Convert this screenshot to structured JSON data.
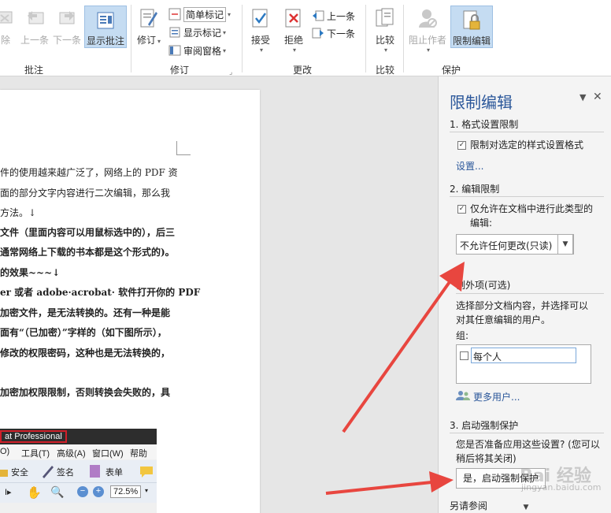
{
  "ribbon": {
    "buttons": {
      "delete": "除",
      "prev": "上一条",
      "next": "下一条",
      "show_comments": "显示批注",
      "track": "修订",
      "markup_select": "简单标记",
      "show_markup": "显示标记",
      "review_pane": "审阅窗格",
      "accept": "接受",
      "reject": "拒绝",
      "prev_change": "上一条",
      "next_change": "下一条",
      "compare": "比较",
      "block_authors": "阻止作者",
      "restrict_editing": "限制编辑"
    },
    "groups": {
      "comments": "批注",
      "tracking": "修订",
      "changes": "更改",
      "compare": "比较",
      "protect": "保护"
    }
  },
  "document": {
    "lines": [
      "件的使用越来越广泛了，网络上的 PDF 资",
      "面的部分文字内容进行二次编辑，那么我",
      "方法。↓",
      "文件（里面内容可以用鼠标选中的），后三",
      "通常网络上下载的书本都是这个形式的)。",
      "的效果~~~↓",
      "er 或者 adobe·acrobat· 软件打开你的 PDF",
      "加密文件，是无法转换的。还有一种是能",
      "面有“（已加密）”字样的（如下图所示），",
      "修改的权限密码，这种也是无法转换的，",
      "加密加权限限制，否则转换会失败的，具"
    ],
    "embedded": {
      "title": "at Professional",
      "menu": [
        "O)",
        "工具(T)",
        "高级(A)",
        "窗口(W)",
        "帮助(H)"
      ],
      "tools": [
        "安全",
        "签名",
        "表单"
      ],
      "zoom": "72.5%"
    }
  },
  "pane": {
    "title": "限制编辑",
    "section1": "1. 格式设置限制",
    "format_check": "限制对选定的样式设置格式",
    "settings_link": "设置...",
    "section2": "2. 编辑限制",
    "edit_check_line1": "仅允许在文档中进行此类型的",
    "edit_check_line2": "编辑:",
    "edit_type": "不允许任何更改(只读)",
    "exceptions_title": "例外项(可选)",
    "exceptions_desc_line1": "选择部分文档内容，并选择可以",
    "exceptions_desc_line2": "对其任意编辑的用户。",
    "groups_label": "组:",
    "everyone": "每个人",
    "more_users": "更多用户...",
    "section3": "3. 启动强制保护",
    "enforce_question_line1": "您是否准备应用这些设置? (您可以",
    "enforce_question_line2": "稍后将其关闭)",
    "enforce_button": "是，启动强制保护",
    "also_see": "另请参阅"
  },
  "watermark": {
    "text": "Bai 经验",
    "url": "jingyan.baidu.com"
  },
  "colors": {
    "accent": "#2b579a",
    "arrow": "#e8463f",
    "selected_tab": "#c5dcf2"
  }
}
